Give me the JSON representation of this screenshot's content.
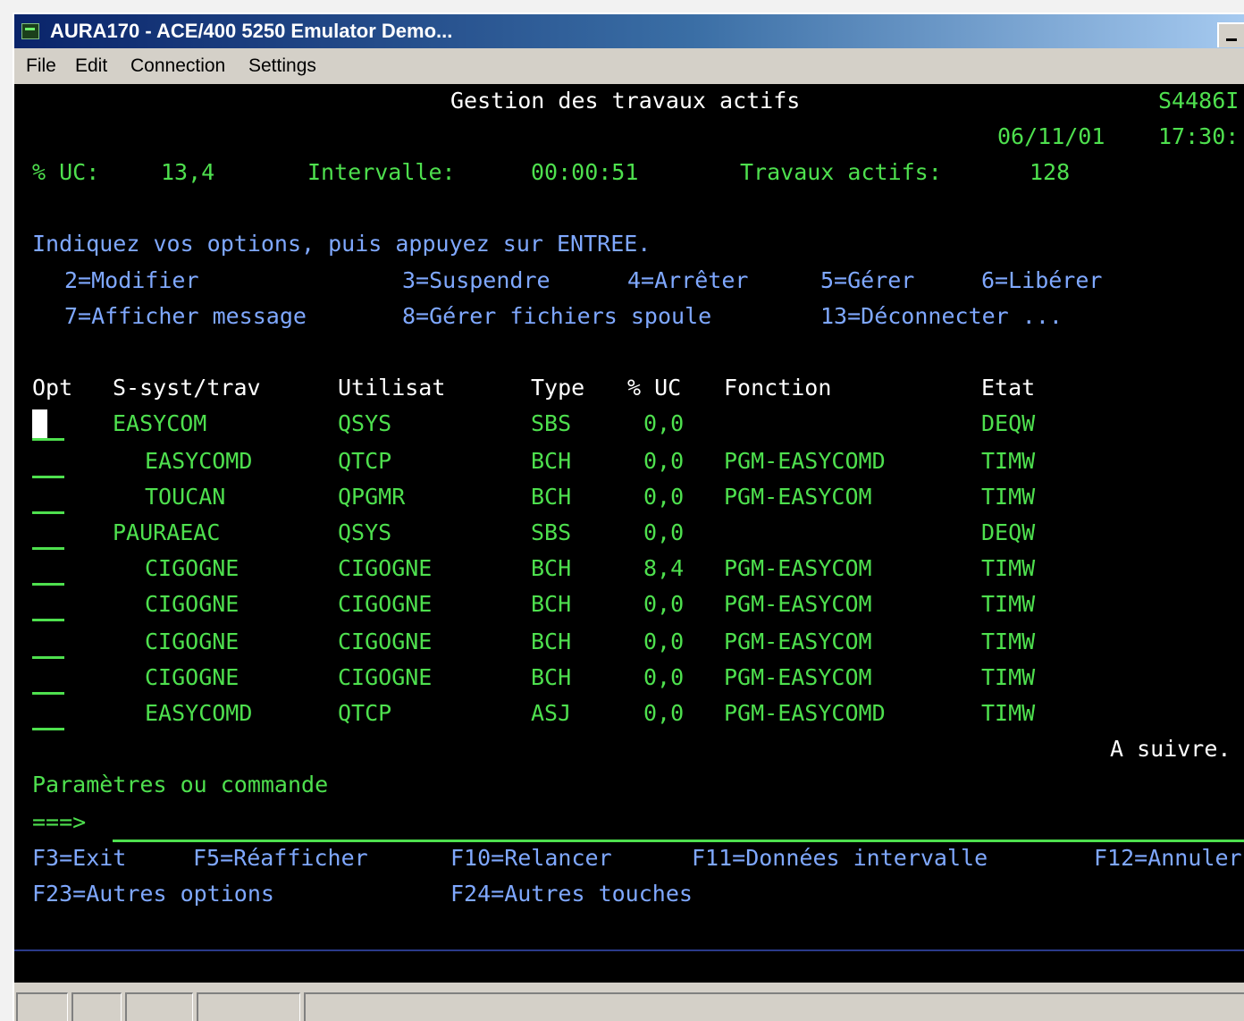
{
  "window": {
    "title": "AURA170 - ACE/400 5250 Emulator Demo...",
    "icon": "terminal-icon",
    "minimize_icon": "minimize-icon"
  },
  "menu": [
    "File",
    "Edit",
    "Connection",
    "Settings"
  ],
  "screen": {
    "title": "Gestion des travaux actifs",
    "system": "S4486I",
    "date": "06/11/01",
    "time": "17:30:",
    "stats": {
      "cpu_label": "% UC:",
      "cpu_value": "13,4",
      "interval_label": "Intervalle:",
      "interval_value": "00:00:51",
      "active_label": "Travaux actifs:",
      "active_value": "128"
    },
    "instructions": "Indiquez vos options, puis appuyez sur ENTREE.",
    "options": [
      "2=Modifier",
      "3=Suspendre",
      "4=Arrêter",
      "5=Gérer",
      "6=Libérer",
      "7=Afficher message",
      "8=Gérer fichiers spoule",
      "13=Déconnecter ..."
    ],
    "columns": [
      "Opt",
      "S-syst/trav",
      "Utilisat",
      "Type",
      "% UC",
      "Fonction",
      "Etat"
    ],
    "rows": [
      {
        "job": "EASYCOM",
        "user": "QSYS",
        "type": "SBS",
        "cpu": "0,0",
        "function": "",
        "status": "DEQW"
      },
      {
        "job": "EASYCOMD",
        "user": "QTCP",
        "type": "BCH",
        "cpu": "0,0",
        "function": "PGM-EASYCOMD",
        "status": "TIMW"
      },
      {
        "job": "TOUCAN",
        "user": "QPGMR",
        "type": "BCH",
        "cpu": "0,0",
        "function": "PGM-EASYCOM",
        "status": "TIMW"
      },
      {
        "job": "PAURAEAC",
        "user": "QSYS",
        "type": "SBS",
        "cpu": "0,0",
        "function": "",
        "status": "DEQW"
      },
      {
        "job": "CIGOGNE",
        "user": "CIGOGNE",
        "type": "BCH",
        "cpu": "8,4",
        "function": "PGM-EASYCOM",
        "status": "TIMW"
      },
      {
        "job": "CIGOGNE",
        "user": "CIGOGNE",
        "type": "BCH",
        "cpu": "0,0",
        "function": "PGM-EASYCOM",
        "status": "TIMW"
      },
      {
        "job": "CIGOGNE",
        "user": "CIGOGNE",
        "type": "BCH",
        "cpu": "0,0",
        "function": "PGM-EASYCOM",
        "status": "TIMW"
      },
      {
        "job": "CIGOGNE",
        "user": "CIGOGNE",
        "type": "BCH",
        "cpu": "0,0",
        "function": "PGM-EASYCOM",
        "status": "TIMW"
      },
      {
        "job": "EASYCOMD",
        "user": "QTCP",
        "type": "ASJ",
        "cpu": "0,0",
        "function": "PGM-EASYCOMD",
        "status": "TIMW"
      }
    ],
    "more": "A suivre.",
    "command_label": "Paramètres ou commande",
    "prompt": "===>",
    "fkeys": [
      "F3=Exit",
      "F5=Réafficher",
      "F10=Relancer",
      "F11=Données intervalle",
      "F12=Annuler",
      "F23=Autres options",
      "F24=Autres touches"
    ]
  },
  "colors": {
    "terminal_bg": "#000000",
    "green": "#4ee04e",
    "blue": "#7fa8ff",
    "white": "#ffffff"
  }
}
